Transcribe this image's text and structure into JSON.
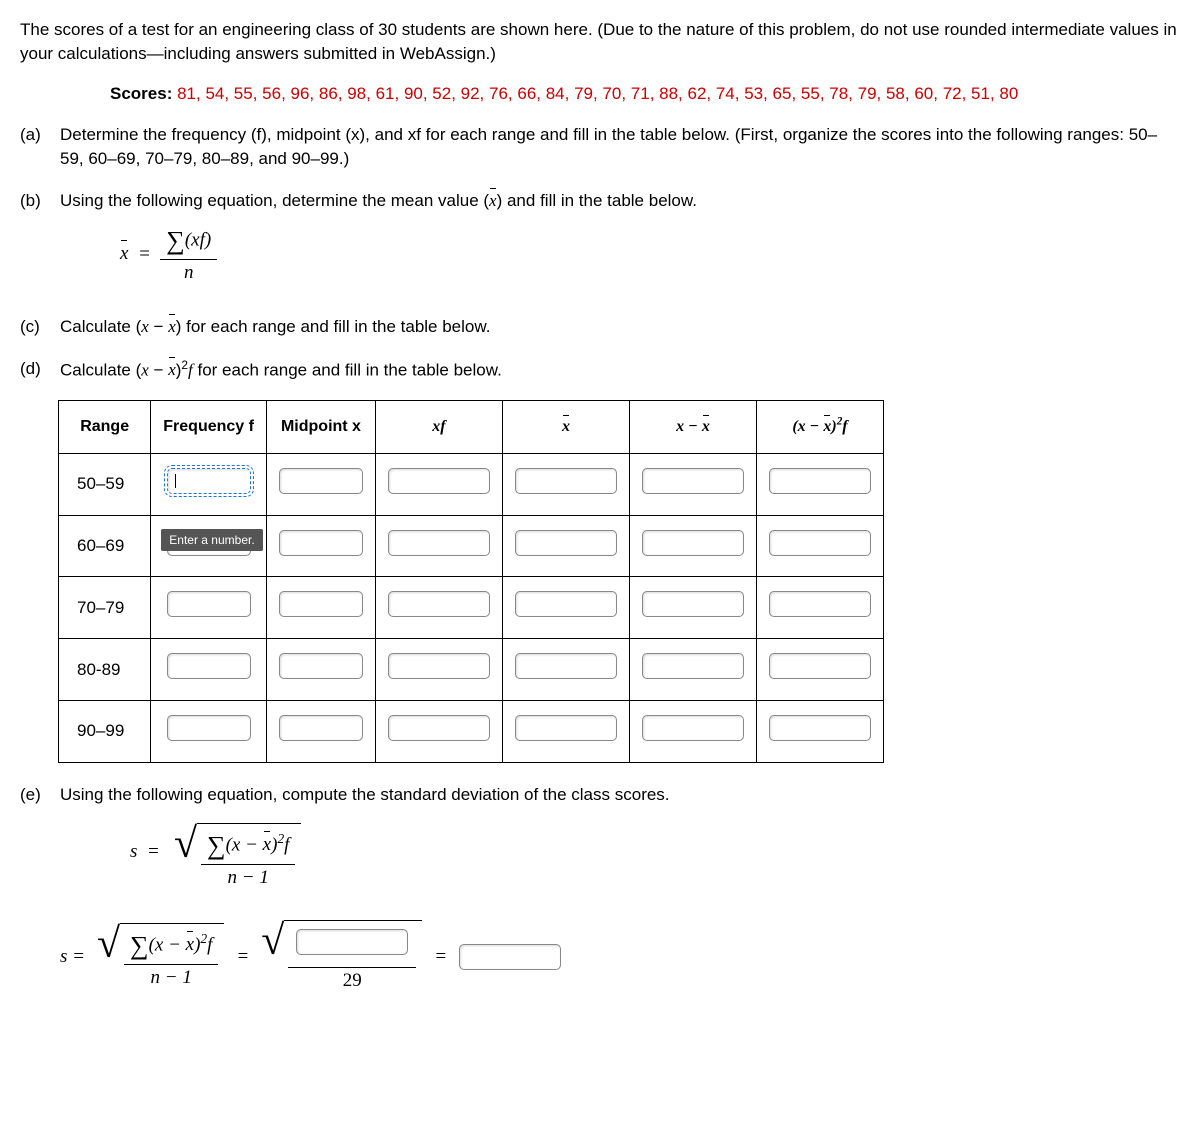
{
  "intro": "The scores of a test for an engineering class of 30 students are shown here. (Due to the nature of this problem, do not use rounded intermediate values in your calculations—including answers submitted in WebAssign.)",
  "scores_label": "Scores: ",
  "scores_values": "81, 54, 55, 56, 96, 86, 98, 61, 90, 52, 92, 76, 66, 84, 79, 70, 71, 88, 62, 74, 53, 65, 55, 78, 79, 58, 60, 72, 51, 80",
  "parts": {
    "a": {
      "label": "(a)",
      "text": "Determine the frequency (f), midpoint (x), and xf for each range and fill in the table below. (First, organize the scores into the following ranges: 50–59, 60–69, 70–79, 80–89, and 90–99.)"
    },
    "b": {
      "label": "(b)",
      "text": "Using the following equation, determine the mean value (x) and fill in the table below."
    },
    "c": {
      "label": "(c)",
      "text": "Calculate (x − x) for each range and fill in the table below."
    },
    "d": {
      "label": "(d)",
      "text": "Calculate (x − x)²f for each range and fill in the table below."
    },
    "e": {
      "label": "(e)",
      "text": "Using the following equation, compute the standard deviation of the class scores."
    }
  },
  "equations": {
    "mean_lhs": "x =",
    "mean_num": "∑(xf)",
    "mean_den": "n",
    "sd_lhs": "s =",
    "sd_num": "∑(x − x)²f",
    "sd_den": "n − 1",
    "sd_denom_value": "29",
    "equals": "="
  },
  "table": {
    "headers": {
      "range": "Range",
      "freq": "Frequency f",
      "mid": "Midpoint x",
      "xf": "xf",
      "xbar": "x",
      "xmx": "x − x",
      "xmx2f": "(x − x)²f"
    },
    "rows": [
      {
        "range": "50–59"
      },
      {
        "range": "60–69"
      },
      {
        "range": "70–79"
      },
      {
        "range": "80-89"
      },
      {
        "range": "90–99"
      }
    ]
  },
  "tooltip": "Enter a number."
}
